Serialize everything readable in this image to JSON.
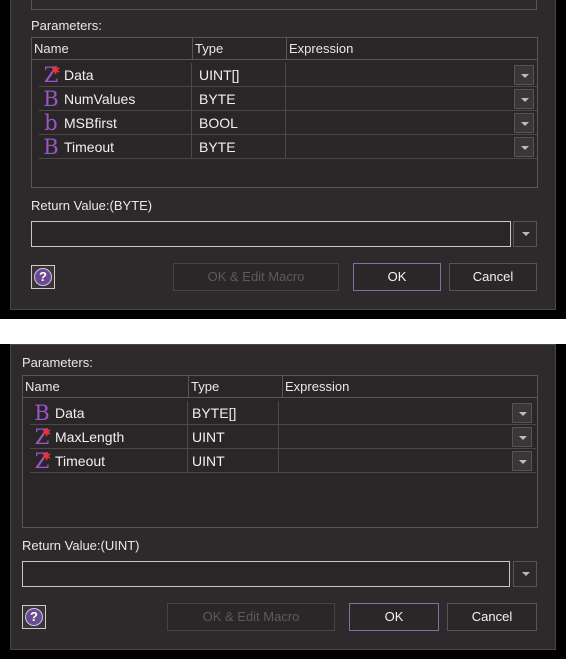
{
  "dialogs": [
    {
      "parameters_label": "Parameters:",
      "columns": [
        "Name",
        "Type",
        "Expression"
      ],
      "rows": [
        {
          "icon": "Z",
          "star": true,
          "name": "Data",
          "type": "UINT[]",
          "expression": ""
        },
        {
          "icon": "B",
          "star": false,
          "name": "NumValues",
          "type": "BYTE",
          "expression": ""
        },
        {
          "icon": "b",
          "star": false,
          "name": "MSBfirst",
          "type": "BOOL",
          "expression": ""
        },
        {
          "icon": "B",
          "star": false,
          "name": "Timeout",
          "type": "BYTE",
          "expression": ""
        }
      ],
      "return_label": "Return Value:(BYTE)",
      "return_value": "",
      "buttons": {
        "help": "?",
        "ok_edit": "OK & Edit Macro",
        "ok": "OK",
        "cancel": "Cancel"
      }
    },
    {
      "parameters_label": "Parameters:",
      "columns": [
        "Name",
        "Type",
        "Expression"
      ],
      "rows": [
        {
          "icon": "B",
          "star": false,
          "name": "Data",
          "type": "BYTE[]",
          "expression": ""
        },
        {
          "icon": "Z",
          "star": true,
          "name": "MaxLength",
          "type": "UINT",
          "expression": ""
        },
        {
          "icon": "Z",
          "star": true,
          "name": "Timeout",
          "type": "UINT",
          "expression": ""
        }
      ],
      "return_label": "Return Value:(UINT)",
      "return_value": "",
      "buttons": {
        "help": "?",
        "ok_edit": "OK & Edit Macro",
        "ok": "OK",
        "cancel": "Cancel"
      }
    }
  ],
  "colors": {
    "icon_purple": "#9b55c9",
    "star_red": "#ee3333",
    "dialog_bg": "#2e2a2b"
  }
}
